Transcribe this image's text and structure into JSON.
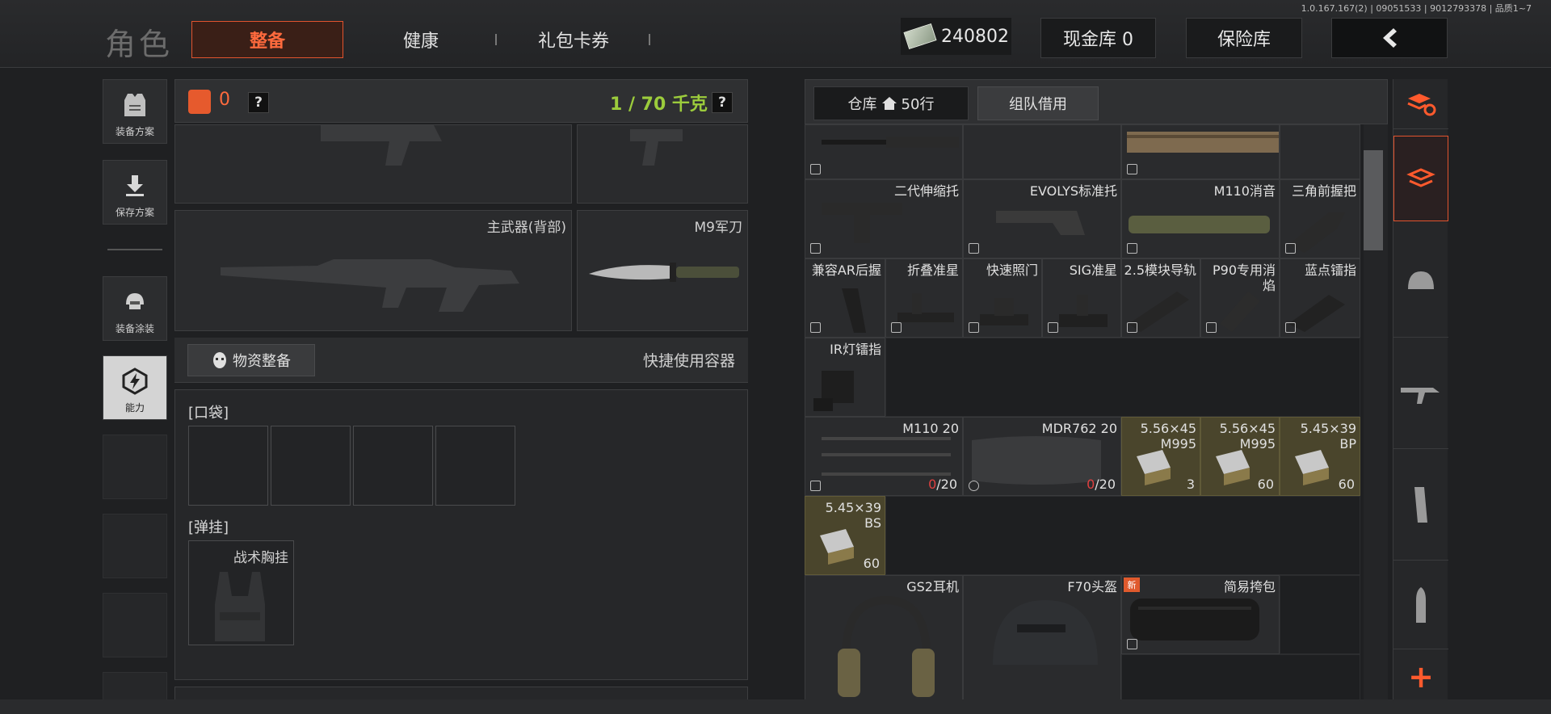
{
  "version": "1.0.167.167(2) | 09051533 | 9012793378 | 品质1~7",
  "header": {
    "title": "角色",
    "tabs": [
      "整备",
      "健康",
      "礼包卡券"
    ],
    "money": "240802",
    "cash_vault": "现金库 0",
    "safe": "保险库"
  },
  "sidebar": {
    "items": [
      "装备方案",
      "保存方案",
      "装备涂装",
      "能力"
    ]
  },
  "left": {
    "bag_count": "0",
    "weight": "1 / 70 千克",
    "help": "?",
    "primary_back": "主武器(背部)",
    "knife": "M9军刀",
    "supply_btn": "物资整备",
    "quick_container": "快捷使用容器",
    "pocket_label": "[口袋]",
    "rig_label": "[弹挂]",
    "rig_item": "战术胸挂"
  },
  "right": {
    "tab_warehouse": "仓库",
    "tab_rows": "50行",
    "tab_borrow": "组队借用",
    "items": {
      "stock2": "二代伸缩托",
      "evolys": "EVOLYS标准托",
      "m110sup": "M110消音",
      "tri_grip": "三角前握把",
      "ar_grip": "兼容AR后握",
      "fold_sight": "折叠准星",
      "quick_sight": "快速照门",
      "sig_sight": "SIG准星",
      "rail25": "2.5模块导轨",
      "p90muz": "P90专用消焰",
      "blue_laser": "蓝点镭指",
      "ir_laser": "IR灯镭指",
      "m110mag": "M110 20",
      "m110mag_count": "0",
      "m110mag_cap": "/20",
      "mdrmag": "MDR762 20",
      "mdrmag_count": "0",
      "mdrmag_cap": "/20",
      "ammo1_name": "5.56×45 M995",
      "ammo1_count": "3",
      "ammo2_name": "5.56×45 M995",
      "ammo2_count": "60",
      "ammo3_name": "5.45×39 BP",
      "ammo3_count": "60",
      "ammo4_name": "5.45×39 BS",
      "ammo4_count": "60",
      "gs2": "GS2耳机",
      "f70": "F70头盔",
      "new": "新",
      "pouch": "简易挎包"
    }
  },
  "colors": {
    "accent": "#e2542e",
    "weight_green": "#9ccc3c",
    "ammo_bg": "#4a452c"
  }
}
